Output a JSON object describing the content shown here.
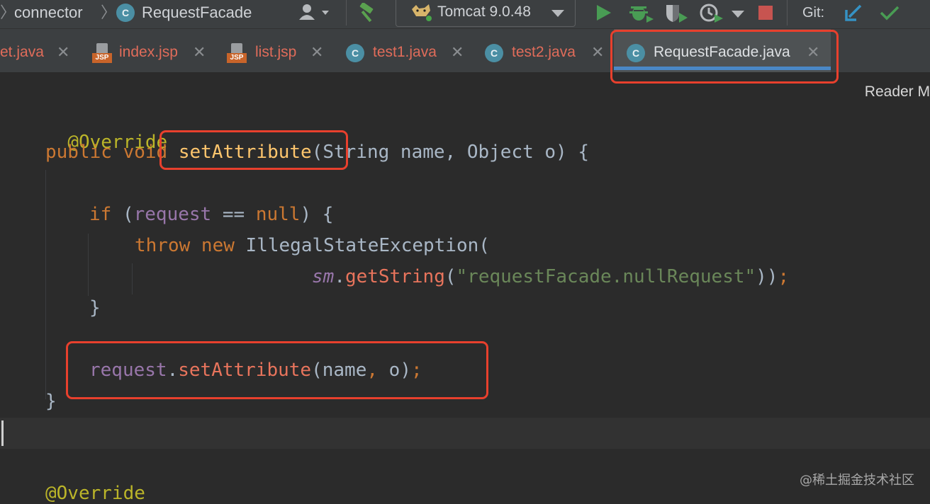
{
  "navbar": {
    "breadcrumb_sep": "〉",
    "breadcrumb_folder": "connector",
    "breadcrumb_class_icon": "C",
    "breadcrumb_class": "RequestFacade",
    "run_config": "Tomcat 9.0.48",
    "git_label": "Git:",
    "icons": [
      "user-icon",
      "hammer-icon",
      "tomcat-icon",
      "run-icon",
      "debug-icon",
      "coverage-icon",
      "profile-icon",
      "stop-icon",
      "git-update-icon",
      "git-commit-icon"
    ]
  },
  "tabs": [
    {
      "label": "et.java",
      "type": "java-partial",
      "active": false
    },
    {
      "label": "index.jsp",
      "type": "jsp",
      "active": false
    },
    {
      "label": "list.jsp",
      "type": "jsp",
      "active": false
    },
    {
      "label": "test1.java",
      "type": "java",
      "active": false
    },
    {
      "label": "test2.java",
      "type": "java",
      "active": false
    },
    {
      "label": "RequestFacade.java",
      "type": "java",
      "active": true
    }
  ],
  "tab_close_glyph": "✕",
  "class_icon_letter": "C",
  "jsp_icon_label": "JSP",
  "editor": {
    "reader_mode": "Reader M",
    "lines": {
      "l1": "@Override",
      "l2_kw": "public void ",
      "l2_fn": "setAttribute",
      "l2_rest": "(String name, Object o) {",
      "l3_kw": "if ",
      "l3_p1": "(",
      "l3_fld": "request",
      "l3_op": " == ",
      "l3_null": "null",
      "l3_end": ") {",
      "l4_kw": "throw new ",
      "l4_rest": "IllegalStateException(",
      "l5_fld": "sm",
      "l5_dot": ".",
      "l5_m": "getString",
      "l5_p": "(",
      "l5_str": "\"requestFacade.nullRequest\"",
      "l5_end": "))",
      "l5_semi": ";",
      "l6": "}",
      "l7_fld": "request",
      "l7_dot": ".",
      "l7_m": "setAttribute",
      "l7_args": "(name",
      "l7_comma": ", ",
      "l7_o": "o)",
      "l7_semi": ";",
      "l8": "}",
      "l9": "@Override"
    }
  },
  "watermark": "@稀土掘金技术社区",
  "colors": {
    "keyword": "#cc7832",
    "annotation": "#bbb529",
    "method_decl": "#ffc66d",
    "field": "#9876aa",
    "string": "#6a8759",
    "highlight_border": "#e8402d",
    "active_tab_underline": "#4a88c7"
  }
}
